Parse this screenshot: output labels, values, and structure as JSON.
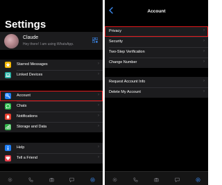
{
  "left": {
    "title": "Settings",
    "profile": {
      "name": "Claude",
      "status": "Hey there! I am using WhatsApp."
    },
    "groups": [
      [
        {
          "label": "Starred Messages",
          "icon": "star-icon",
          "color": "#f5b800"
        },
        {
          "label": "Linked Devices",
          "icon": "laptop-icon",
          "color": "#2ab3a6"
        }
      ],
      [
        {
          "label": "Account",
          "icon": "key-icon",
          "color": "#1f7ef5",
          "highlighted": true
        },
        {
          "label": "Chats",
          "icon": "chat-icon",
          "color": "#2dbd4e"
        },
        {
          "label": "Notifications",
          "icon": "bell-icon",
          "color": "#e8402f"
        },
        {
          "label": "Storage and Data",
          "icon": "storage-icon",
          "color": "#32b24a"
        }
      ],
      [
        {
          "label": "Help",
          "icon": "info-icon",
          "color": "#1f7ef5"
        },
        {
          "label": "Tell a Friend",
          "icon": "heart-icon",
          "color": "#e8404d"
        }
      ]
    ]
  },
  "right": {
    "title": "Account",
    "groups": [
      [
        {
          "label": "Privacy",
          "highlighted": true
        },
        {
          "label": "Security"
        },
        {
          "label": "Two-Step Verification"
        },
        {
          "label": "Change Number"
        }
      ],
      [
        {
          "label": "Request Account Info"
        },
        {
          "label": "Delete My Account"
        }
      ]
    ]
  },
  "tabs": [
    {
      "label": "Status",
      "icon": "status-icon"
    },
    {
      "label": "Calls",
      "icon": "calls-icon"
    },
    {
      "label": "Camera",
      "icon": "camera-icon"
    },
    {
      "label": "Chats",
      "icon": "chats-icon"
    },
    {
      "label": "Settings",
      "icon": "settings-icon",
      "active": true
    }
  ],
  "colors": {
    "highlight": "#e3191c",
    "accent": "#3d8cf2",
    "background": "#000000",
    "cell": "#1c1c1e"
  }
}
